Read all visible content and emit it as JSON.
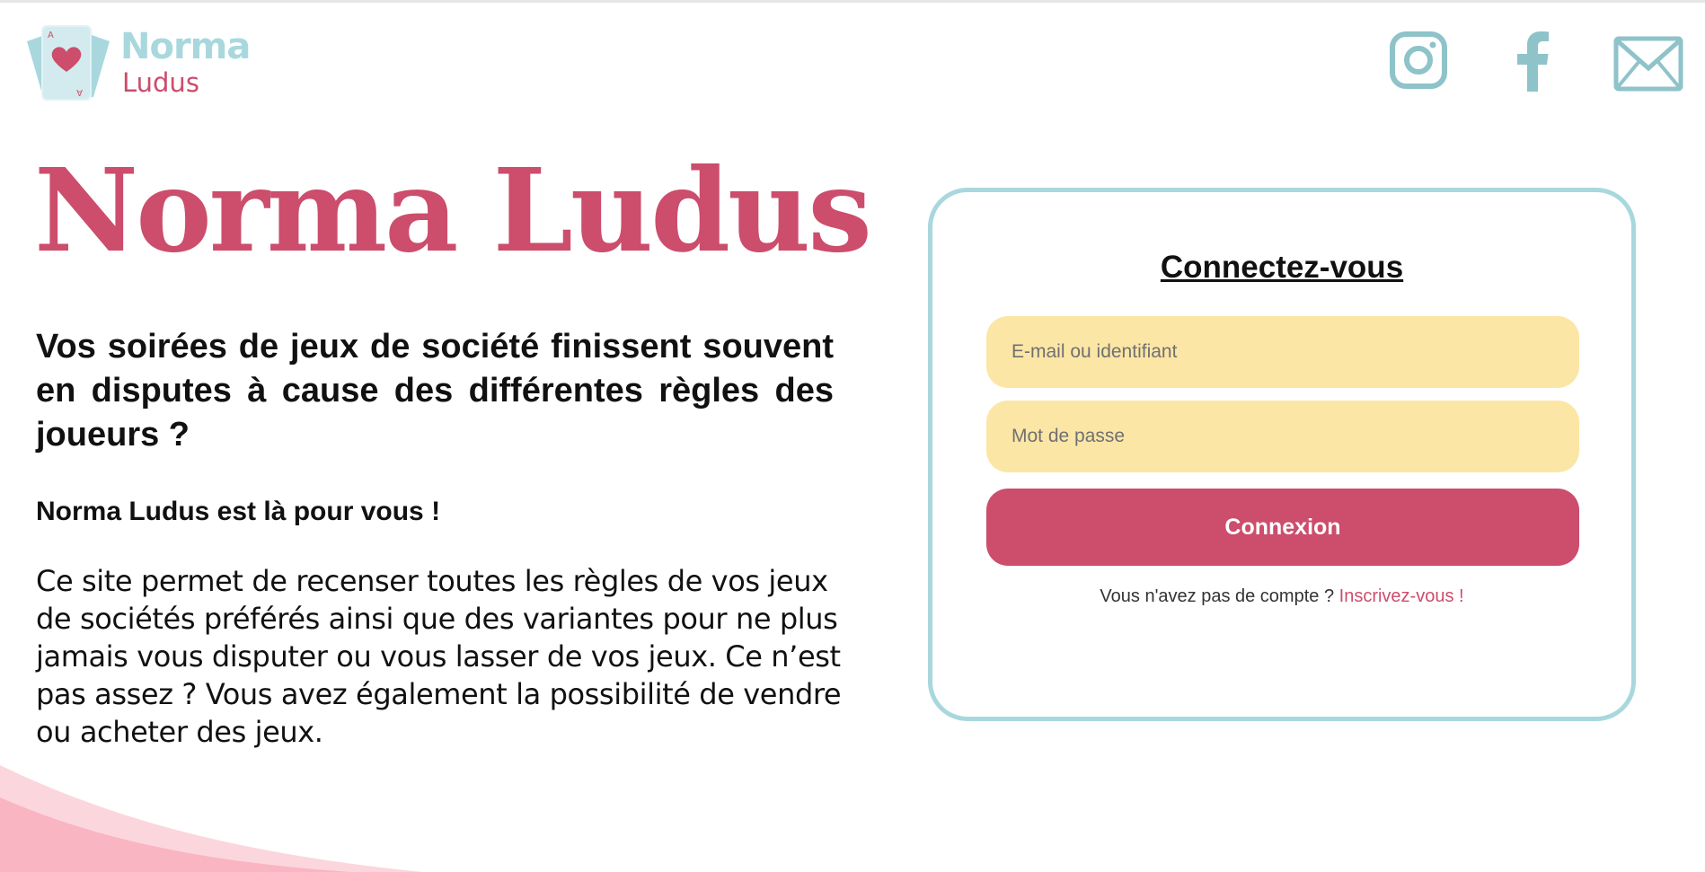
{
  "colors": {
    "brand_pink": "#cc4d6c",
    "brand_teal": "#a8d8dd",
    "icon_teal": "#8ec3c9",
    "field_yellow": "#fce6a6",
    "wave_pink": "#f9b5c1"
  },
  "header": {
    "logo": {
      "icon": "playing-card-heart-icon",
      "title": "Norma",
      "subtitle": "Ludus"
    },
    "social": [
      {
        "icon": "instagram-icon"
      },
      {
        "icon": "facebook-icon"
      },
      {
        "icon": "mail-icon"
      }
    ]
  },
  "hero": {
    "title": "Norma Ludus",
    "question": "Vos soirées de jeux de société finissent souvent en disputes à cause des différentes règles des joueurs ?",
    "subheading": "Norma Ludus est là pour vous !",
    "body": "Ce site permet de recenser toutes les règles de vos jeux de sociétés préférés ainsi que des variantes pour ne plus jamais vous disputer ou vous lasser de vos jeux. Ce n’est pas assez ? Vous avez également la possibilité de vendre ou acheter des jeux."
  },
  "login": {
    "title": "Connectez-vous",
    "email_placeholder": "E-mail ou identifiant",
    "email_value": "",
    "password_placeholder": "Mot de passe",
    "password_value": "",
    "submit_label": "Connexion",
    "signup_prompt": "Vous n'avez pas de compte ?",
    "signup_link": "Inscrivez-vous !"
  }
}
